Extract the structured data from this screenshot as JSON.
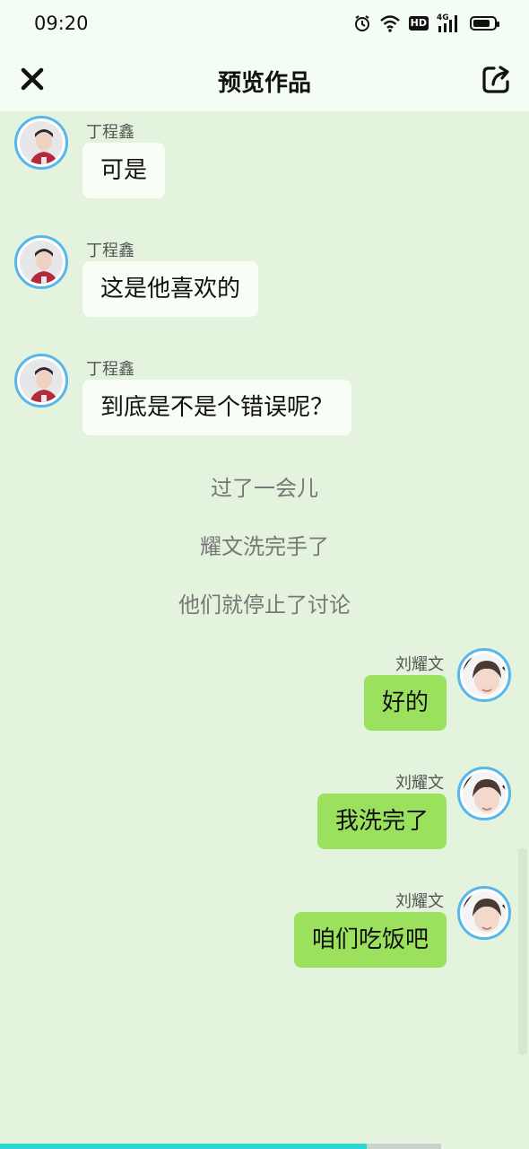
{
  "status_bar": {
    "time": "09:20",
    "hd_label": "HD",
    "network_label": "4G",
    "icons": [
      "alarm-icon",
      "wifi-icon",
      "hd-icon",
      "signal-icon",
      "battery-icon"
    ]
  },
  "header": {
    "title": "预览作品",
    "close_icon": "close-icon",
    "share_icon": "share-icon"
  },
  "messages": [
    {
      "side": "left",
      "sender": "丁程鑫",
      "text": "可是"
    },
    {
      "side": "left",
      "sender": "丁程鑫",
      "text": "这是他喜欢的"
    },
    {
      "side": "left",
      "sender": "丁程鑫",
      "text": "到底是不是个错误呢？"
    },
    {
      "side": "right",
      "sender": "刘耀文",
      "text": "好的"
    },
    {
      "side": "right",
      "sender": "刘耀文",
      "text": "我洗完了"
    },
    {
      "side": "right",
      "sender": "刘耀文",
      "text": "咱们吃饭吧"
    }
  ],
  "narrations": [
    "过了一会儿",
    "耀文洗完手了",
    "他们就停止了讨论"
  ],
  "colors": {
    "background": "#e4f3dd",
    "left_bubble": "#f8fdf5",
    "right_bubble": "#9be15d",
    "avatar_ring": "#57b6ea",
    "progress": "#2ed6cf"
  },
  "progress": 0.7
}
